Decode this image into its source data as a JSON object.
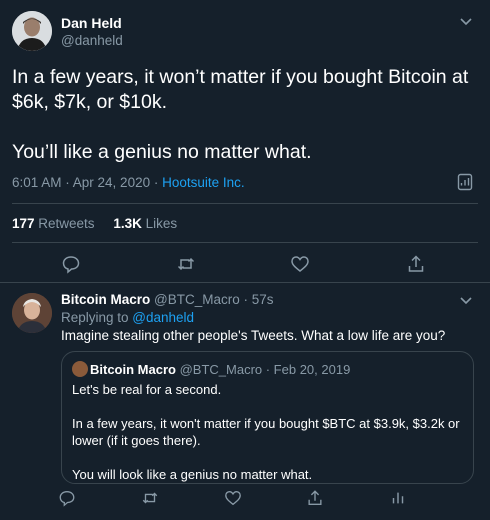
{
  "main_tweet": {
    "author_name": "Dan Held",
    "handle": "@danheld",
    "text": "In a few years, it won’t matter if you bought Bitcoin at $6k, $7k, or $10k.\n\nYou’ll like a genius no matter what.",
    "time": "6:01 AM · Apr 24, 2020 · ",
    "source": "Hootsuite Inc.",
    "retweets_count": "177",
    "retweets_label": " Retweets",
    "likes_count": "1.3K",
    "likes_label": " Likes"
  },
  "reply": {
    "author_name": "Bitcoin Macro",
    "handle_time": " @BTC_Macro · 57s",
    "replying_prefix": "Replying to ",
    "replying_to": "@danheld",
    "text": "Imagine stealing other people's Tweets. What a low life are you?",
    "quote": {
      "author_name": "Bitcoin Macro",
      "handle_date": " @BTC_Macro · Feb 20, 2019",
      "text": "Let's be real for a second.\n\nIn a few years, it won't matter if you bought $BTC at $3.9k, $3.2k or lower (if it goes there).\n\nYou will look like a genius no matter what."
    }
  },
  "icons": [
    "chevron-down-icon",
    "analytics-icon",
    "reply-icon",
    "retweet-icon",
    "like-icon",
    "share-icon",
    "stats-icon"
  ],
  "colors": {
    "background": "#15202b",
    "secondary_text": "#8899a6",
    "accent": "#1da1f2",
    "border": "#38444d"
  }
}
